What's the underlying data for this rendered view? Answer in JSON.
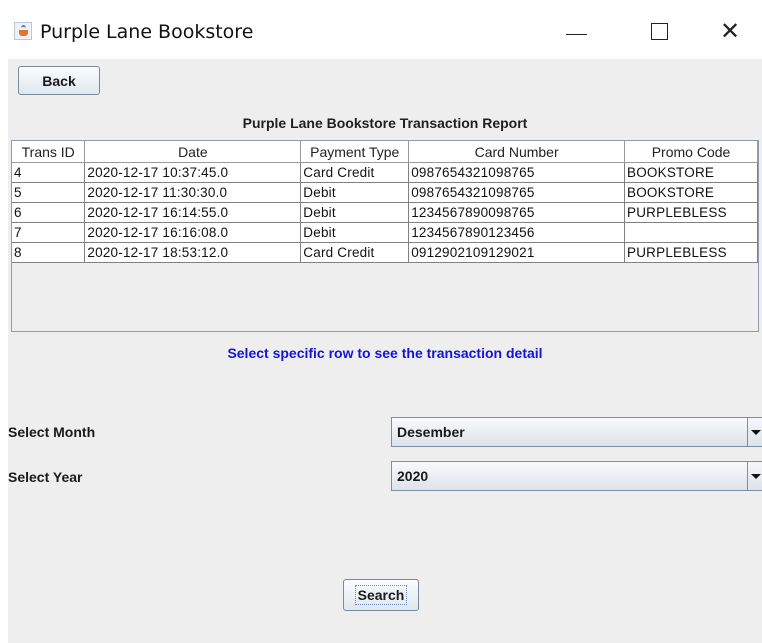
{
  "window": {
    "title": "Purple Lane Bookstore",
    "icon": "java-cup-icon",
    "controls": {
      "minimize": "minimize-icon",
      "maximize": "maximize-icon",
      "close": "✕"
    }
  },
  "toolbar": {
    "back_label": "Back"
  },
  "report": {
    "title": "Purple Lane Bookstore Transaction Report",
    "columns": [
      "Trans ID",
      "Date",
      "Payment Type",
      "Card Number",
      "Promo Code"
    ],
    "rows": [
      [
        "4",
        "2020-12-17 10:37:45.0",
        "Card Credit",
        "0987654321098765",
        "BOOKSTORE"
      ],
      [
        "5",
        "2020-12-17 11:30:30.0",
        "Debit",
        "0987654321098765",
        "BOOKSTORE"
      ],
      [
        "6",
        "2020-12-17 16:14:55.0",
        "Debit",
        "1234567890098765",
        "PURPLEBLESS"
      ],
      [
        "7",
        "2020-12-17 16:16:08.0",
        "Debit",
        "1234567890123456",
        ""
      ],
      [
        "8",
        "2020-12-17 18:53:12.0",
        "Card Credit",
        "0912902109129021",
        "PURPLEBLESS"
      ]
    ]
  },
  "hint": "Select specific row to see the transaction detail",
  "filters": {
    "month_label": "Select Month",
    "month_value": "Desember",
    "year_label": "Select Year",
    "year_value": "2020"
  },
  "search_label": "Search",
  "colors": {
    "hint": "#1414d8",
    "panel": "#eeeeee"
  }
}
